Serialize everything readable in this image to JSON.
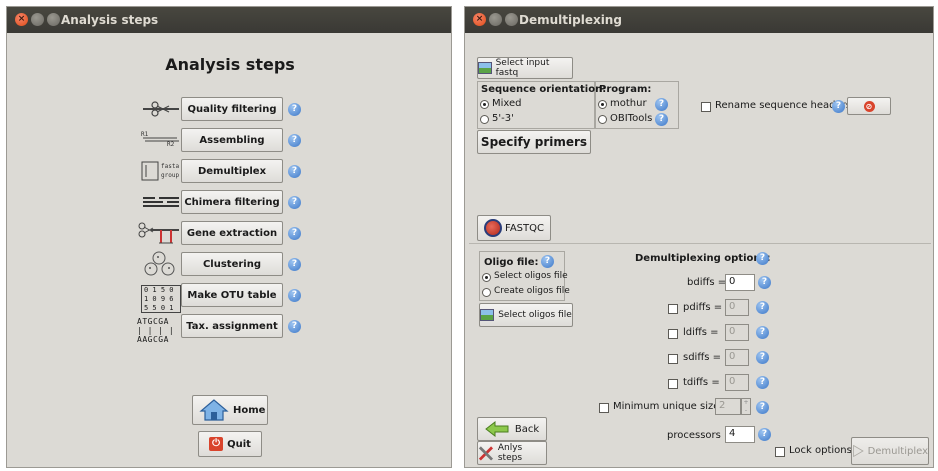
{
  "left_window": {
    "title": "Analysis steps",
    "heading": "Analysis steps",
    "steps": [
      {
        "label": "Quality filtering",
        "icon": "scissors-icon"
      },
      {
        "label": "Assembling",
        "icon": "reads-merge-icon",
        "icon_text_1": "R1",
        "icon_text_2": "R2"
      },
      {
        "label": "Demultiplex",
        "icon": "fasta-group-icon",
        "icon_text_1": "fasta",
        "icon_text_2": "group"
      },
      {
        "label": "Chimera filtering",
        "icon": "chimera-icon"
      },
      {
        "label": "Gene extraction",
        "icon": "gene-cut-icon"
      },
      {
        "label": "Clustering",
        "icon": "clusters-icon"
      },
      {
        "label": "Make OTU table",
        "icon": "table-icon",
        "icon_rows": [
          "0 1 5 0",
          "1 0 9 6",
          "5 5 0 1"
        ]
      },
      {
        "label": "Tax. assignment",
        "icon": "sequence-align-icon",
        "icon_rows": [
          "ATGCGA",
          "| | | |",
          "AAGCGA"
        ]
      }
    ],
    "home_label": "Home",
    "quit_label": "Quit"
  },
  "right_window": {
    "title": "Demultiplexing",
    "select_input_label": "Select input fastq",
    "orientation": {
      "title": "Sequence orientation:",
      "options": [
        "Mixed",
        "5'-3'"
      ],
      "selected": "Mixed"
    },
    "program": {
      "title": "Program:",
      "options": [
        "mothur",
        "OBITools"
      ],
      "selected": "mothur"
    },
    "rename_label": "Rename sequence headers",
    "specify_primers_label": "Specify primers",
    "fastqc_label": "FASTQC",
    "oligo": {
      "title": "Oligo file:",
      "options": [
        "Select oligos file",
        "Create oligos file"
      ],
      "selected": "Select oligos file",
      "button_label": "Select oligos file"
    },
    "demux_options_title": "Demultiplexing options:",
    "bdiffs": {
      "label": "bdiffs =",
      "value": "0"
    },
    "pdiffs": {
      "label": "pdiffs =",
      "value": "0"
    },
    "ldiffs": {
      "label": "ldiffs =",
      "value": "0"
    },
    "sdiffs": {
      "label": "sdiffs =",
      "value": "0"
    },
    "tdiffs": {
      "label": "tdiffs =",
      "value": "0"
    },
    "min_unique": {
      "label": "Minimum unique size =",
      "value": "2"
    },
    "processors": {
      "label": "processors =",
      "value": "4"
    },
    "back_label": "Back",
    "anlys_label": "Anlys steps",
    "lock_label": "Lock options",
    "demux_button_label": "Demultiplex"
  },
  "colors": {
    "titlebar": "#3c3b37",
    "window_bg": "#dcdad5",
    "help": "#3d78c8",
    "close": "#df4b16"
  }
}
